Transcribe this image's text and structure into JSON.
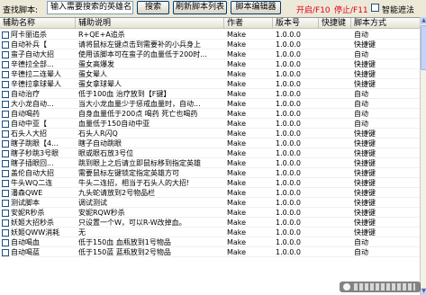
{
  "toolbar": {
    "search_label": "查找脚本:",
    "search_value": "输入需要搜索的英雄名",
    "search_button": "搜索",
    "refresh_button": "刷新脚本列表",
    "editor_button": "脚本编辑器",
    "start_label": "开启/F10",
    "stop_label": "停止/F11",
    "smart_mask_label": "智能遮法"
  },
  "table": {
    "columns": [
      "辅助名称",
      "辅助说明",
      "作者",
      "版本号",
      "快捷键",
      "脚本方式"
    ],
    "rows": [
      {
        "name": "阿卡丽追杀",
        "desc": "R+QE+A追杀",
        "author": "Make",
        "version": "1.0.0.0",
        "key": "",
        "mode": "自动"
      },
      {
        "name": "自动补兵【",
        "desc": "请将鼠标左键点击到需要补的小兵身上",
        "author": "Make",
        "version": "1.0.0.0",
        "key": "",
        "mode": "快捷键"
      },
      {
        "name": "蛮子自动大招",
        "desc": "使用该脚本可在蛮子的血量低于200时...",
        "author": "Make",
        "version": "1.0.0.0",
        "key": "",
        "mode": "自动"
      },
      {
        "name": "辛德拉全部...",
        "desc": "蛋女高爆发",
        "author": "Make",
        "version": "1.0.0.0",
        "key": "",
        "mode": "快捷键"
      },
      {
        "name": "辛德拉二连晕人",
        "desc": "蛋女晕人",
        "author": "Make",
        "version": "1.0.0.0",
        "key": "",
        "mode": "快捷键"
      },
      {
        "name": "辛德拉拿球晕人",
        "desc": "蛋女拿球晕人",
        "author": "Make",
        "version": "1.0.0.0",
        "key": "",
        "mode": "快捷键"
      },
      {
        "name": "自动治疗",
        "desc": "低于100血 治疗放到【F键】",
        "author": "Make",
        "version": "1.0.0.0",
        "key": "",
        "mode": "自动"
      },
      {
        "name": "大小龙自动...",
        "desc": "当大小龙血量少于惩戒血量时，自动...",
        "author": "Make",
        "version": "1.0.0.0",
        "key": "",
        "mode": "自动"
      },
      {
        "name": "自动喝药",
        "desc": "自身血量低于200点 喝药 死亡也喝药",
        "author": "Make",
        "version": "1.0.0.0",
        "key": "",
        "mode": "自动"
      },
      {
        "name": "自动中亚【",
        "desc": "血量低于150自动中亚",
        "author": "Make",
        "version": "1.0.0.0",
        "key": "",
        "mode": "自动"
      },
      {
        "name": "石头人大招",
        "desc": "石头人R闪Q",
        "author": "Make",
        "version": "1.0.0.0",
        "key": "",
        "mode": "快捷键"
      },
      {
        "name": "瞎子跳眼【4...",
        "desc": "瞎子自动跳眼",
        "author": "Make",
        "version": "1.0.0.0",
        "key": "",
        "mode": "快捷键"
      },
      {
        "name": "瞎子秒跳3号眼",
        "desc": "眼或眼石放3号位",
        "author": "Make",
        "version": "1.0.0.0",
        "key": "",
        "mode": "快捷键"
      },
      {
        "name": "瞎子插眼回...",
        "desc": "跳到眼上之后请立即鼠标移到指定英雄",
        "author": "Make",
        "version": "1.0.0.0",
        "key": "",
        "mode": "快捷键"
      },
      {
        "name": "盖伦自动大招",
        "desc": "需要鼠标左键锁定指定英雄方可",
        "author": "Make",
        "version": "1.0.0.0",
        "key": "",
        "mode": "快捷键"
      },
      {
        "name": "牛头WQ二连",
        "desc": "牛头二连招，相当于石头人的大招!",
        "author": "Make",
        "version": "1.0.0.0",
        "key": "",
        "mode": "快捷键"
      },
      {
        "name": "潘森QWE",
        "desc": "九头蛇请放到2号物品栏",
        "author": "Make",
        "version": "1.0.0.0",
        "key": "",
        "mode": "快捷键"
      },
      {
        "name": "测试脚本",
        "desc": "调试测试",
        "author": "Make",
        "version": "1.0.0.0",
        "key": "",
        "mode": "快捷键"
      },
      {
        "name": "安妮R秒杀",
        "desc": "安妮RQW秒杀",
        "author": "Make",
        "version": "1.0.0.0",
        "key": "",
        "mode": "快捷键"
      },
      {
        "name": "妖姬大招秒杀",
        "desc": "只设置一个W，可以R-W改掉血。",
        "author": "Make",
        "version": "1.0.0.0",
        "key": "",
        "mode": "快捷键"
      },
      {
        "name": "妖姬QWW消耗",
        "desc": "无",
        "author": "Make",
        "version": "1.0.0.0",
        "key": "",
        "mode": "快捷键"
      },
      {
        "name": "自动喝血",
        "desc": "低于150血 血瓶放到1号物品",
        "author": "Make",
        "version": "1.0.0.0",
        "key": "",
        "mode": "自动"
      },
      {
        "name": "自动喝蓝",
        "desc": "低于150蓝 蓝瓶放到2号物品",
        "author": "Make",
        "version": "1.0.0.0",
        "key": "",
        "mode": "自动"
      }
    ]
  },
  "colors": {
    "accent_red": "#e0001b",
    "toolbar_bg": "#ece9d8"
  }
}
